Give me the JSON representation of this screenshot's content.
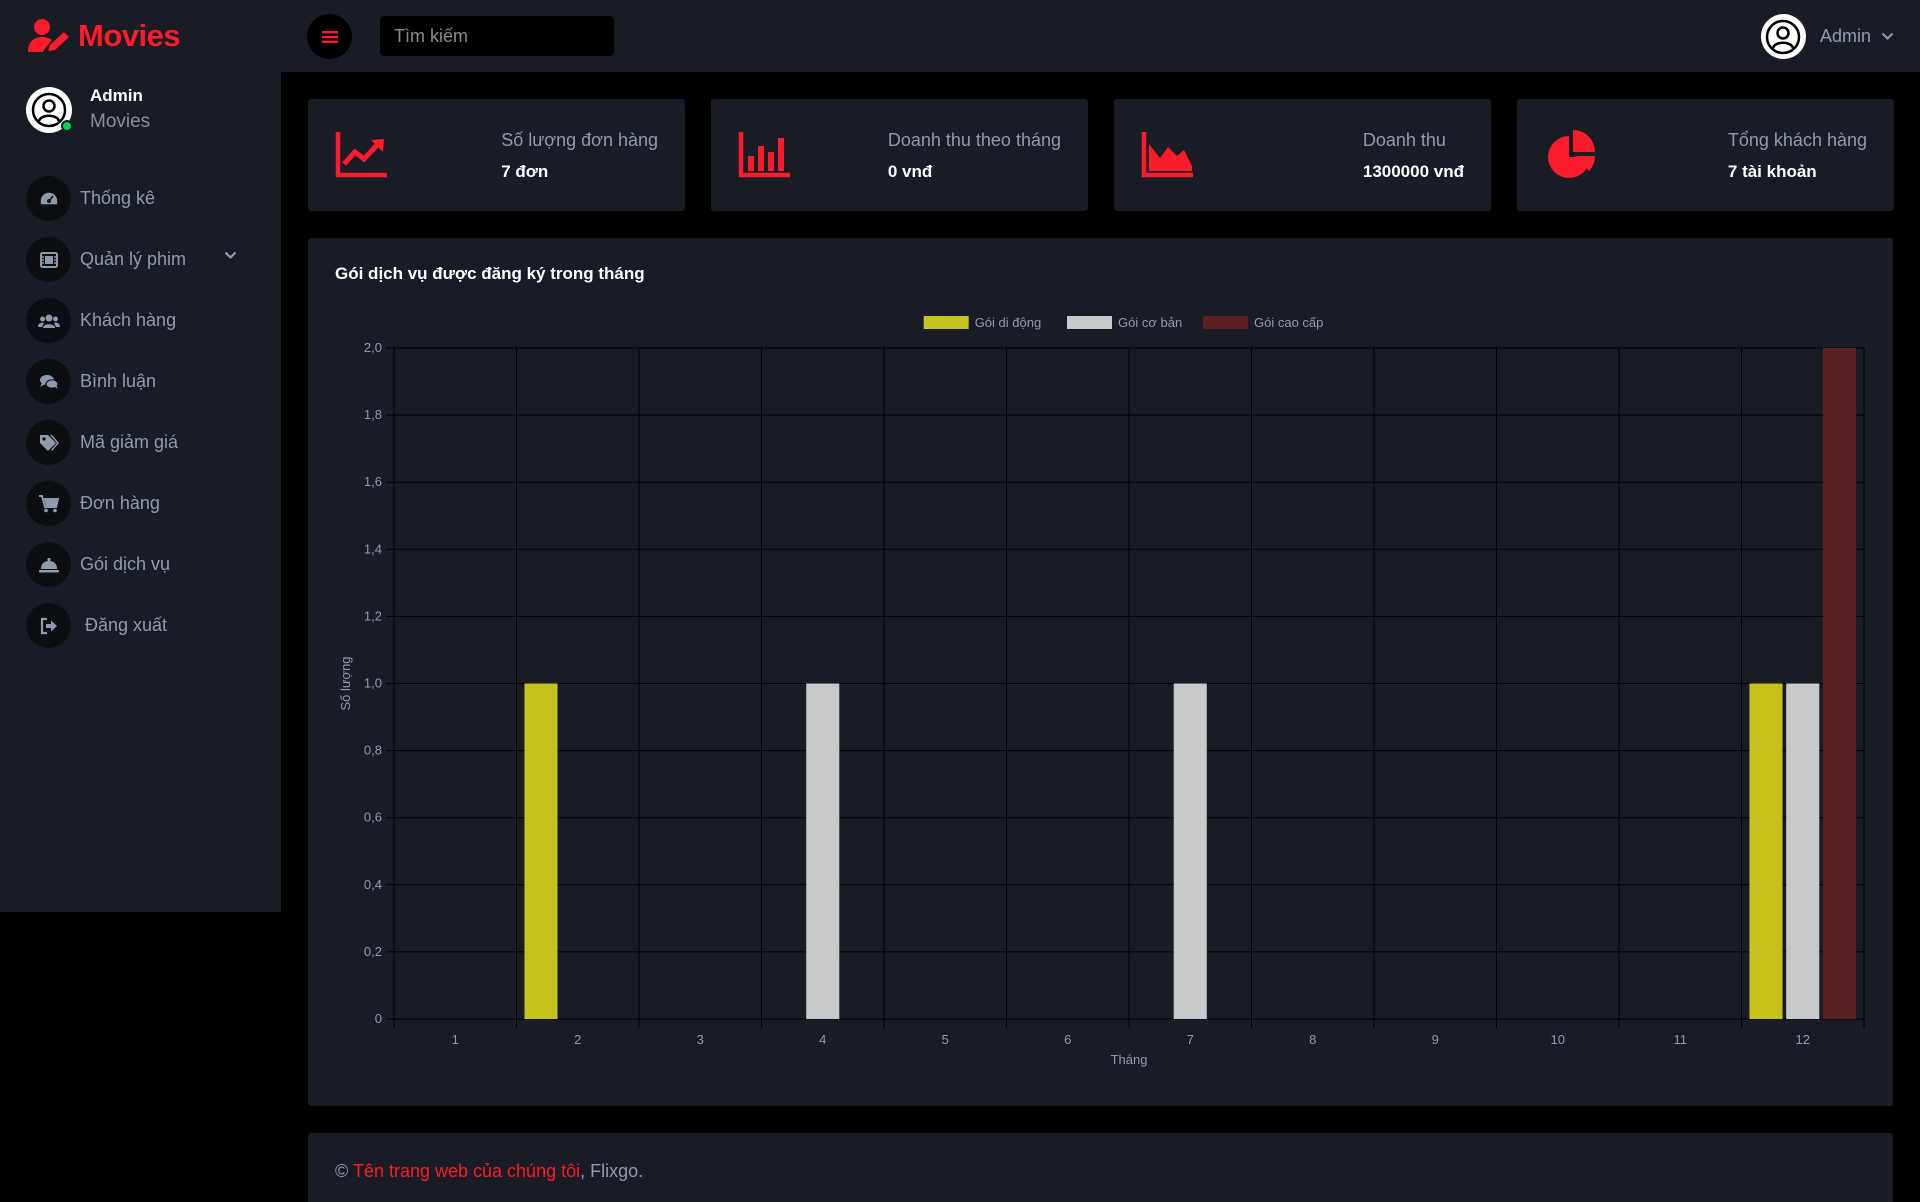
{
  "brand": {
    "name": "Movies",
    "color": "#fc1b2a"
  },
  "profile": {
    "name": "Admin",
    "role": "Movies",
    "status_color": "#00d25b"
  },
  "nav": {
    "items": [
      {
        "label": "Thống kê",
        "icon": "dashboard-gauge-icon"
      },
      {
        "label": "Quản lý phim",
        "icon": "film-icon",
        "has_submenu": true
      },
      {
        "label": "Khách hàng",
        "icon": "users-icon"
      },
      {
        "label": "Bình luận",
        "icon": "comments-icon"
      },
      {
        "label": "Mã giảm giá",
        "icon": "tags-icon"
      },
      {
        "label": "Đơn hàng",
        "icon": "shopping-cart-icon"
      },
      {
        "label": "Gói dịch vụ",
        "icon": "concierge-bell-icon"
      },
      {
        "label": "Đăng xuất",
        "icon": "sign-out-icon"
      }
    ]
  },
  "topbar": {
    "search_placeholder": "Tìm kiếm",
    "user_name": "Admin"
  },
  "stats": [
    {
      "title": "Số lượng đơn hàng",
      "value": "7 đơn",
      "icon": "chart-line-up-icon"
    },
    {
      "title": "Doanh thu theo tháng",
      "value": "0 vnđ",
      "icon": "chart-bar-icon"
    },
    {
      "title": "Doanh thu",
      "value": "1300000 vnđ",
      "icon": "chart-area-icon"
    },
    {
      "title": "Tổng khách hàng",
      "value": "7 tài khoản",
      "icon": "chart-pie-icon"
    }
  ],
  "chart": {
    "title": "Gói dịch vụ được đăng ký trong tháng"
  },
  "chart_data": {
    "type": "bar",
    "categories": [
      "1",
      "2",
      "3",
      "4",
      "5",
      "6",
      "7",
      "8",
      "9",
      "10",
      "11",
      "12"
    ],
    "series": [
      {
        "name": "Gói di động",
        "color": "#c4c21b",
        "values": [
          0,
          1,
          0,
          0,
          0,
          0,
          0,
          0,
          0,
          0,
          0,
          1
        ]
      },
      {
        "name": "Gói cơ bản",
        "color": "#c8c9cb",
        "values": [
          0,
          0,
          0,
          1,
          0,
          0,
          1,
          0,
          0,
          0,
          0,
          1
        ]
      },
      {
        "name": "Gói cao cấp",
        "color": "#5c1f22",
        "values": [
          0,
          0,
          0,
          0,
          0,
          0,
          0,
          0,
          0,
          0,
          0,
          2
        ]
      }
    ],
    "xlabel": "Tháng",
    "ylabel": "Số lượng",
    "ylim": [
      0,
      2
    ],
    "yticks": [
      "0",
      "0,2",
      "0,4",
      "0,6",
      "0,8",
      "1,0",
      "1,2",
      "1,4",
      "1,6",
      "1,8",
      "2,0"
    ],
    "grid": true,
    "legend": "top-center"
  },
  "footer": {
    "prefix": "© ",
    "link_text": "Tên trang web của chúng tôi",
    "suffix": ", Flixgo."
  }
}
